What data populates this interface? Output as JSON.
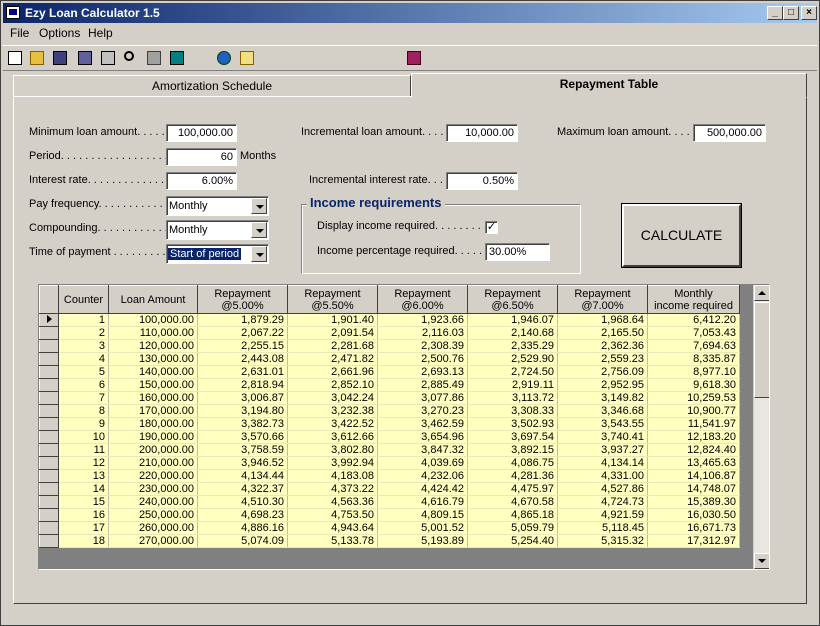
{
  "window": {
    "title": "Ezy Loan Calculator  1.5"
  },
  "menu": {
    "file": "File",
    "options": "Options",
    "help": "Help"
  },
  "toolbar": {
    "icons": [
      "new-icon",
      "open-icon",
      "save-icon",
      "save-as-icon",
      "print-icon",
      "search-icon",
      "bank-icon",
      "calculator-icon",
      "globe-icon",
      "mail-icon",
      "book-icon"
    ]
  },
  "tabs": {
    "amortization": "Amortization Schedule",
    "repayment": "Repayment Table"
  },
  "form": {
    "min_loan_label": "Minimum loan amount. . . . .",
    "min_loan_value": "100,000.00",
    "inc_loan_label": "Incremental loan amount. . . . .",
    "inc_loan_value": "10,000.00",
    "max_loan_label": "Maximum loan amount. . . . .",
    "max_loan_value": "500,000.00",
    "period_label": "Period. . . . . . . . . . . . . . . . . . .",
    "period_value": "60",
    "period_unit": "Months",
    "interest_label": "Interest rate. . . . . . . . . . . . . .",
    "interest_value": "6.00%",
    "inc_interest_label": "Incremental interest rate. . . .",
    "inc_interest_value": "0.50%",
    "pay_freq_label": "Pay frequency. . . . . . . . . . . .",
    "pay_freq_value": "Monthly",
    "compounding_label": "Compounding. . . . . . . . . . . . .",
    "compounding_value": "Monthly",
    "time_payment_label": "Time of payment . . . . . . . . . .",
    "time_payment_value": "Start of period"
  },
  "income": {
    "title": "Income requirements",
    "display_label": "Display income required. . . . . . . . .",
    "display_checked": "✓",
    "percent_label": "Income percentage required. . . . . .",
    "percent_value": "30.00%"
  },
  "calculate_label": "CALCULATE",
  "grid": {
    "headers": [
      "Counter",
      "Loan Amount",
      "Repayment\n@5.00%",
      "Repayment\n@5.50%",
      "Repayment\n@6.00%",
      "Repayment\n@6.50%",
      "Repayment\n@7.00%",
      "Monthly\nincome required"
    ],
    "rows": [
      [
        "1",
        "100,000.00",
        "1,879.29",
        "1,901.40",
        "1,923.66",
        "1,946.07",
        "1,968.64",
        "6,412.20"
      ],
      [
        "2",
        "110,000.00",
        "2,067.22",
        "2,091.54",
        "2,116.03",
        "2,140.68",
        "2,165.50",
        "7,053.43"
      ],
      [
        "3",
        "120,000.00",
        "2,255.15",
        "2,281.68",
        "2,308.39",
        "2,335.29",
        "2,362.36",
        "7,694.63"
      ],
      [
        "4",
        "130,000.00",
        "2,443.08",
        "2,471.82",
        "2,500.76",
        "2,529.90",
        "2,559.23",
        "8,335.87"
      ],
      [
        "5",
        "140,000.00",
        "2,631.01",
        "2,661.96",
        "2,693.13",
        "2,724.50",
        "2,756.09",
        "8,977.10"
      ],
      [
        "6",
        "150,000.00",
        "2,818.94",
        "2,852.10",
        "2,885.49",
        "2,919.11",
        "2,952.95",
        "9,618.30"
      ],
      [
        "7",
        "160,000.00",
        "3,006.87",
        "3,042.24",
        "3,077.86",
        "3,113.72",
        "3,149.82",
        "10,259.53"
      ],
      [
        "8",
        "170,000.00",
        "3,194.80",
        "3,232.38",
        "3,270.23",
        "3,308.33",
        "3,346.68",
        "10,900.77"
      ],
      [
        "9",
        "180,000.00",
        "3,382.73",
        "3,422.52",
        "3,462.59",
        "3,502.93",
        "3,543.55",
        "11,541.97"
      ],
      [
        "10",
        "190,000.00",
        "3,570.66",
        "3,612.66",
        "3,654.96",
        "3,697.54",
        "3,740.41",
        "12,183.20"
      ],
      [
        "11",
        "200,000.00",
        "3,758.59",
        "3,802.80",
        "3,847.32",
        "3,892.15",
        "3,937.27",
        "12,824.40"
      ],
      [
        "12",
        "210,000.00",
        "3,946.52",
        "3,992.94",
        "4,039.69",
        "4,086.75",
        "4,134.14",
        "13,465.63"
      ],
      [
        "13",
        "220,000.00",
        "4,134.44",
        "4,183.08",
        "4,232.06",
        "4,281.36",
        "4,331.00",
        "14,106.87"
      ],
      [
        "14",
        "230,000.00",
        "4,322.37",
        "4,373.22",
        "4,424.42",
        "4,475.97",
        "4,527.86",
        "14,748.07"
      ],
      [
        "15",
        "240,000.00",
        "4,510.30",
        "4,563.36",
        "4,616.79",
        "4,670.58",
        "4,724.73",
        "15,389.30"
      ],
      [
        "16",
        "250,000.00",
        "4,698.23",
        "4,753.50",
        "4,809.15",
        "4,865.18",
        "4,921.59",
        "16,030.50"
      ],
      [
        "17",
        "260,000.00",
        "4,886.16",
        "4,943.64",
        "5,001.52",
        "5,059.79",
        "5,118.45",
        "16,671.73"
      ],
      [
        "18",
        "270,000.00",
        "5,074.09",
        "5,133.78",
        "5,193.89",
        "5,254.40",
        "5,315.32",
        "17,312.97"
      ]
    ]
  }
}
